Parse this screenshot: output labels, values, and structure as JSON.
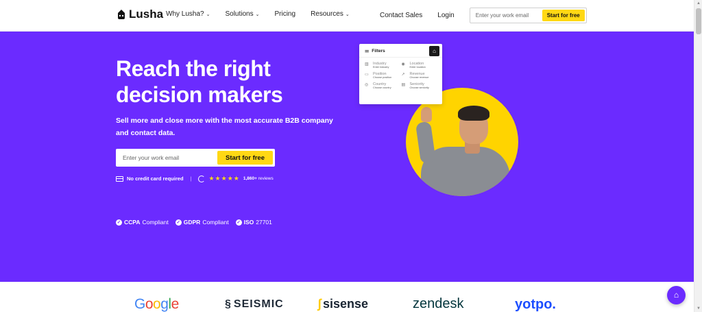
{
  "header": {
    "brand": "Lusha",
    "nav": [
      {
        "label": "Why Lusha?",
        "dropdown": true
      },
      {
        "label": "Solutions",
        "dropdown": true
      },
      {
        "label": "Pricing",
        "dropdown": false
      },
      {
        "label": "Resources",
        "dropdown": true
      }
    ],
    "contact_sales": "Contact Sales",
    "login": "Login",
    "email_placeholder": "Enter your work email",
    "cta": "Start for free"
  },
  "hero": {
    "headline": "Reach the right decision makers",
    "subhead": "Sell more and close more with the most accurate B2B company and contact data.",
    "email_placeholder": "Enter your work email",
    "cta": "Start for free",
    "no_card": "No credit card required",
    "rating_stars": "★★★★★",
    "reviews_count": "1,860+",
    "reviews_label": "reviews",
    "compliance": [
      {
        "strong": "CCPA",
        "rest": "Compliant"
      },
      {
        "strong": "GDPR",
        "rest": "Compliant"
      },
      {
        "strong": "ISO",
        "rest": "27701"
      }
    ]
  },
  "filters_card": {
    "title": "Filters",
    "items": [
      {
        "label": "Industry",
        "sub": "Enter industry",
        "icon": "building-icon"
      },
      {
        "label": "Location",
        "sub": "Enter location",
        "icon": "pin-icon"
      },
      {
        "label": "Position",
        "sub": "Choose position",
        "icon": "briefcase-icon"
      },
      {
        "label": "Revenue",
        "sub": "Choose revenue",
        "icon": "trend-icon"
      },
      {
        "label": "Country",
        "sub": "Choose country",
        "icon": "globe-icon"
      },
      {
        "label": "Seniority",
        "sub": "Choose seniority",
        "icon": "badge-icon"
      }
    ]
  },
  "logos": [
    "Google",
    "SEISMIC",
    "sisense",
    "zendesk",
    "yotpo."
  ],
  "colors": {
    "brand_purple": "#6b2bff",
    "cta_yellow": "#ffd814",
    "circle_yellow": "#ffd400"
  }
}
